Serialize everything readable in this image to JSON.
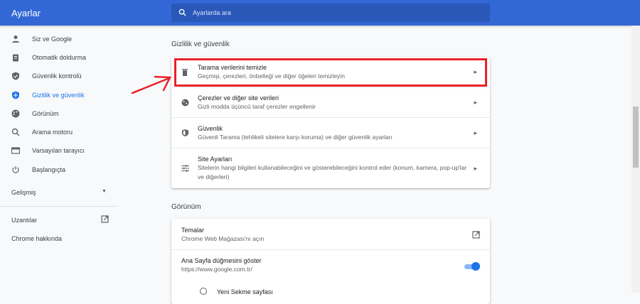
{
  "header": {
    "title": "Ayarlar",
    "search_placeholder": "Ayarlarda ara"
  },
  "sidebar": {
    "items": [
      {
        "label": "Siz ve Google",
        "icon": "person-icon"
      },
      {
        "label": "Otomatik doldurma",
        "icon": "clipboard-icon"
      },
      {
        "label": "Güvenlik kontrolü",
        "icon": "shield-check-icon"
      },
      {
        "label": "Gizlilik ve güvenlik",
        "icon": "shield-icon",
        "active": true
      },
      {
        "label": "Görünüm",
        "icon": "palette-icon"
      },
      {
        "label": "Arama motoru",
        "icon": "search-icon"
      },
      {
        "label": "Varsayılan tarayıcı",
        "icon": "browser-icon"
      },
      {
        "label": "Başlangıçta",
        "icon": "power-icon"
      }
    ],
    "advanced": "Gelişmiş",
    "extensions": "Uzantılar",
    "about": "Chrome hakkında"
  },
  "privacy": {
    "title": "Gizlilik ve güvenlik",
    "rows": [
      {
        "title": "Tarama verilerini temizle",
        "subtitle": "Geçmişi, çerezleri, önbelleği ve diğer öğeleri temizleyin"
      },
      {
        "title": "Çerezler ve diğer site verileri",
        "subtitle": "Gizli modda üçüncü taraf çerezler engellenir"
      },
      {
        "title": "Güvenlik",
        "subtitle": "Güvenli Tarama (tehlikeli sitelere karşı koruma) ve diğer güvenlik ayarları"
      },
      {
        "title": "Site Ayarları",
        "subtitle": "Sitelerin hangi bilgileri kullanabileceğini ve gösterebileceğini kontrol eder (konum, kamera, pop-up'lar ve diğerleri)"
      }
    ]
  },
  "appearance": {
    "title": "Görünüm",
    "themes_title": "Temalar",
    "themes_subtitle": "Chrome Web Mağazası'nı açın",
    "home_title": "Ana Sayfa düğmesini göster",
    "home_url": "https://www.google.com.tr/",
    "home_enabled": true,
    "new_tab": "Yeni Sekme sayfası"
  },
  "colors": {
    "header": "#3367d6",
    "accent": "#1a73e8",
    "highlight": "#e8202a"
  }
}
